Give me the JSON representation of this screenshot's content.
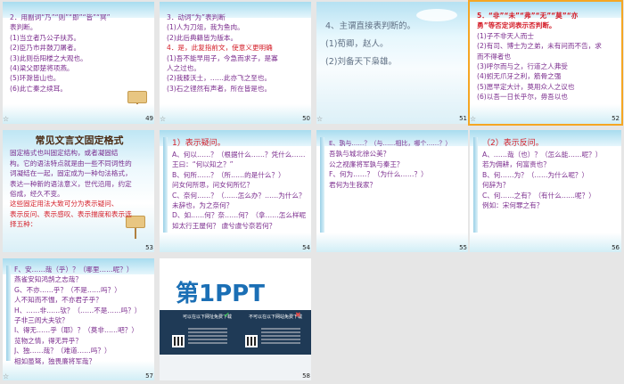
{
  "slides": [
    {
      "number": "49",
      "lines": [
        "2．用副词“乃”“则”“即”“皆”“冥”",
        "表判断。",
        "(1)当立者乃公子扶苏。",
        "(2)臣乃市井鼓刀屠者。",
        "(3)此则岳阳楼之大观也。",
        "(4)梁父即楚将项燕。",
        "(5)环滁皆山也。",
        "(6)此亡秦之续耳。"
      ]
    },
    {
      "number": "50",
      "lines": [
        "3．动词“为”表判断",
        "(1)人为刀俎，我为鱼肉。",
        "(2)此后典籍皆为版本。",
        "4．是，此复指前文，使意义更明确",
        "(1)吾不能早用子，今急而求子，是寡",
        "人之过也。",
        "(2)我膝沃土，……此亦飞之至也。",
        "(3)石之铿然有声者，所在皆是也。"
      ]
    },
    {
      "number": "51",
      "lines": [
        "4、主谓直接表判断的。",
        "(1)荀卿，赵人。",
        "(2)刘备天下枭雄。"
      ]
    },
    {
      "number": "52",
      "lines": [
        "5．“非”“未”“弗”“无”“莫”“亦",
        "勇”等否定词表示否判断。",
        "(1)子不非天人而士",
        "(2)有司、博士为之弟，未有问而不告，求",
        "而不得者也",
        "(3)呼尔而与之，行道之人弗受",
        "(4)蚓无爪牙之利，筋骨之强",
        "(5)愿早定大计，莫用众人之议也",
        "(6)以吾一日长乎尔，毋吾以也"
      ]
    },
    {
      "number": "53",
      "title": "常见文言文固定格式",
      "lines": [
        "固定格式也叫固定结构，或者凝固结",
        "构。它的语法特点就是由一些不同词性的",
        "词凝结在一起，固定成为一种句法格式，",
        "表达一种新的语法意义，世代沿用，约定",
        "俗成，经久不变。",
        "这些固定用法大致可分为表示疑问、",
        "表示反问、表示感叹、表示揣度和表示选",
        "择五种："
      ]
    },
    {
      "number": "54",
      "lines": [
        "1）表示疑问。",
        "A、何以……？（根据什么……？凭什么……？）",
        "王曰：“何以知之？”",
        "B、何所……？（所……的是什么？）",
        "问女何所思，问女何所忆？",
        "C、奈何……？（……怎么办？……为什么？）",
        "未辞也，为之奈何？",
        "D、如……何？奈……何？（拿……怎么样呢？）",
        "如太行王屋何？ 虞兮虞兮奈若何？"
      ]
    },
    {
      "number": "55",
      "lines": [
        "E、孰与……？（与……相比，哪个……？）",
        "吾孰与城北徐公美？",
        "公之视廉将军孰与秦王？",
        "F、何为……？（为什么……？）",
        "君何为生我家？"
      ]
    },
    {
      "number": "56",
      "lines": [
        "（2）表示反问。",
        "A、……哉（也）？（怎么能……呢？）",
        "若为佣耕，何富贵也？",
        "B、何……为？（……为什么呢？）",
        "何辞为？",
        "C、何……之有？（有什么……呢？）",
        "例如：宋何罪之有？"
      ]
    },
    {
      "number": "57",
      "lines": [
        "F、安……哉（乎）？（哪里……呢？）",
        "燕雀安知鸿鹄之志哉？",
        "G、不亦……乎？（不是……吗？）",
        "人不知而不愠，不亦君子乎？",
        "H、……非……欤？（……不是……吗？）",
        "子非三闾大夫欤？",
        "I、得无……乎（耶）？（莫非……吧？）",
        "览物之情，得无异乎？",
        "J、独……哉？（难道……吗？）",
        "相如虽驽，独畏廉将军哉？"
      ]
    },
    {
      "number": "58",
      "brand": "第1PPT",
      "left_caption": "可以在以下网址免费下载",
      "right_caption": "不可以在以下网站免费下载"
    }
  ],
  "active_slide": "52",
  "icons": {
    "slide_star": "star-icon"
  },
  "colors": {
    "accent_outline": "#f5a623",
    "purple": "#7b2d8e",
    "red": "#d41f2a"
  }
}
